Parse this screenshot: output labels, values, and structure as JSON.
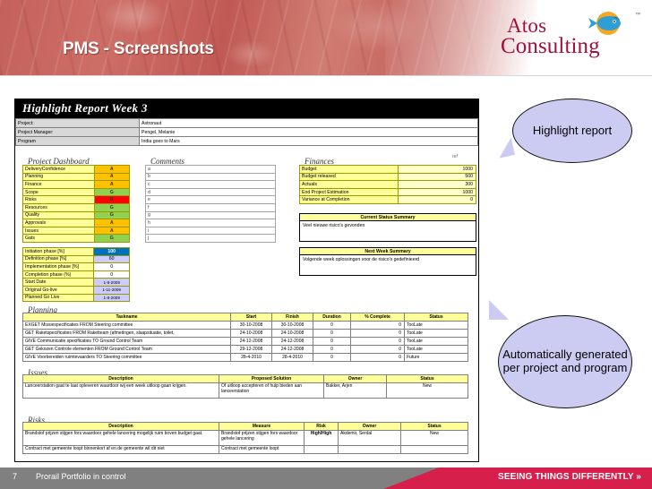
{
  "slide": {
    "title": "PMS - Screenshots",
    "logo": {
      "line1": "Atos",
      "line2": "Consulting",
      "tm": "™"
    }
  },
  "footer": {
    "page_number": "7",
    "text": "Prorail Portfolio in control",
    "slogan": "SEEING THINGS DIFFERENTLY »"
  },
  "report": {
    "title": "Highlight Report Week  3",
    "meta": [
      {
        "label": "Project:",
        "value": "Astronaut"
      },
      {
        "label": "Project Manager:",
        "value": "Pengel, Melanie"
      },
      {
        "label": "Program",
        "value": "India goes to Mars"
      }
    ],
    "sections": {
      "dashboard": "Project Dashboard",
      "comments": "Comments",
      "finances": "Finances",
      "finances_ref": "ref",
      "planning": "Planning",
      "issues": "Issues",
      "risks": "Risks"
    },
    "dashboard": [
      {
        "label": "DeliveryConfidence",
        "value": "A",
        "rag": "A"
      },
      {
        "label": "Planning",
        "value": "A",
        "rag": "A"
      },
      {
        "label": "Finance",
        "value": "A",
        "rag": "A"
      },
      {
        "label": "Scope",
        "value": "G",
        "rag": "G"
      },
      {
        "label": "Risks",
        "value": "R",
        "rag": "R"
      },
      {
        "label": "Resources",
        "value": "G",
        "rag": "G"
      },
      {
        "label": "Quality",
        "value": "G",
        "rag": "G"
      },
      {
        "label": "Approvals",
        "value": "A",
        "rag": "A"
      },
      {
        "label": "Issues",
        "value": "A",
        "rag": "A"
      },
      {
        "label": "Gats",
        "value": "G",
        "rag": "G"
      }
    ],
    "comments": [
      "a",
      "b",
      "c",
      "d",
      "e",
      "f",
      "g",
      "h",
      "i",
      "j"
    ],
    "phases": [
      {
        "label": "Initiation phase [%]",
        "value": "100",
        "style": "blue-full"
      },
      {
        "label": "Definition phase [%]",
        "value": "60",
        "style": "blue-half"
      },
      {
        "label": "Implementation phase [%]",
        "value": "0",
        "style": "plain"
      },
      {
        "label": "Completion phase (%)",
        "value": "0",
        "style": "plain"
      },
      {
        "label": "Start Date",
        "value": "1-8-2009",
        "style": "date"
      },
      {
        "label": "Original Go-live",
        "value": "1-11-2009",
        "style": "date"
      },
      {
        "label": "Planned Go Live",
        "value": "1-8-2009",
        "style": "date"
      }
    ],
    "finances": [
      {
        "label": "Budget",
        "value": "1000"
      },
      {
        "label": "Budget released",
        "value": "500"
      },
      {
        "label": "Actuals",
        "value": "300"
      },
      {
        "label": "End Project Estimation",
        "value": "1000"
      },
      {
        "label": "Variance at Completion",
        "value": "0"
      }
    ],
    "current_status_summary": {
      "header": "Current Status Summary",
      "body": "Veel nieuwe risico's gevonden"
    },
    "next_week_summary": {
      "header": "Next Week Summary",
      "body": "Volgende week oplossingen voor de risico's gedefinieerd"
    },
    "planning": {
      "columns": [
        "Taskname",
        "Start",
        "Finish",
        "Duration",
        "% Complete",
        "Status"
      ],
      "rows": [
        {
          "task": "EXGET Missiespecificaties FROM Steering committee",
          "start": "30-10-2008",
          "finish": "30-10-2008",
          "duration": "0",
          "complete": "0",
          "status": "TooLate",
          "status_style": "late"
        },
        {
          "task": "GET Raketspecificaties FROM Raketteam (afmetingen, slaapsituatie, toilet,",
          "start": "24-10-2008",
          "finish": "24-10-2008",
          "duration": "0",
          "complete": "0",
          "status": "TooLate",
          "status_style": "late"
        },
        {
          "task": "GIVE Communicatie specificaties TO Ground Control Team",
          "start": "24-12-2008",
          "finish": "24-12-2008",
          "duration": "0",
          "complete": "0",
          "status": "TooLate",
          "status_style": "late"
        },
        {
          "task": "GET Gekozen Controle elementen FROM Ground Control Team",
          "start": "29-12-2008",
          "finish": "24-12-2008",
          "duration": "0",
          "complete": "0",
          "status": "TooLate",
          "status_style": "late"
        },
        {
          "task": "GIVE Voorbereiden ruimtevaarders TO Steering committee",
          "start": "28-4-2010",
          "finish": "28-4-2010",
          "duration": "0",
          "complete": "0",
          "status": "Future",
          "status_style": "future"
        }
      ]
    },
    "issues": {
      "columns": [
        "Description",
        "Proposed Solution",
        "Owner",
        "Status"
      ],
      "rows": [
        {
          "description": "Lanceerstation gaat te laat opleveren waardoor wij een week uitloop gaan krijgen.",
          "solution": "Of uitloop accepteren of hulp bieden aan lanceerstation",
          "owner": "Bakker, Arjen",
          "status": "New"
        }
      ]
    },
    "risks": {
      "columns": [
        "Description",
        "Measure",
        "Risk",
        "Owner",
        "Status"
      ],
      "rows": [
        {
          "description": "Brandstof prijzen stijgen fors waardoor gehele lancering mogelijk ruim boven budget gaat.",
          "measure": "Brandstof prijzen stijgen fors waardoor gehele lancering",
          "risk": "High/High",
          "risk_style": "amber",
          "owner": "Akdemir, Serdal",
          "status": "New"
        },
        {
          "description": "Contract met gemeente loopt binnenkort af en de gemeente wil dit niet",
          "measure": "Contract met gemeente loopt",
          "risk": "",
          "risk_style": "red",
          "owner": "",
          "status": ""
        }
      ]
    }
  },
  "callouts": [
    {
      "text": "Highlight report"
    },
    {
      "text": "Automatically generated per project and program"
    }
  ],
  "colors": {
    "banner": "#c4635c",
    "brand_red": "#a0113d",
    "footer_red": "#d71f4b",
    "amber": "#ffc000",
    "green": "#92d050",
    "red": "#ff0000",
    "callout": "#ccccf2"
  }
}
